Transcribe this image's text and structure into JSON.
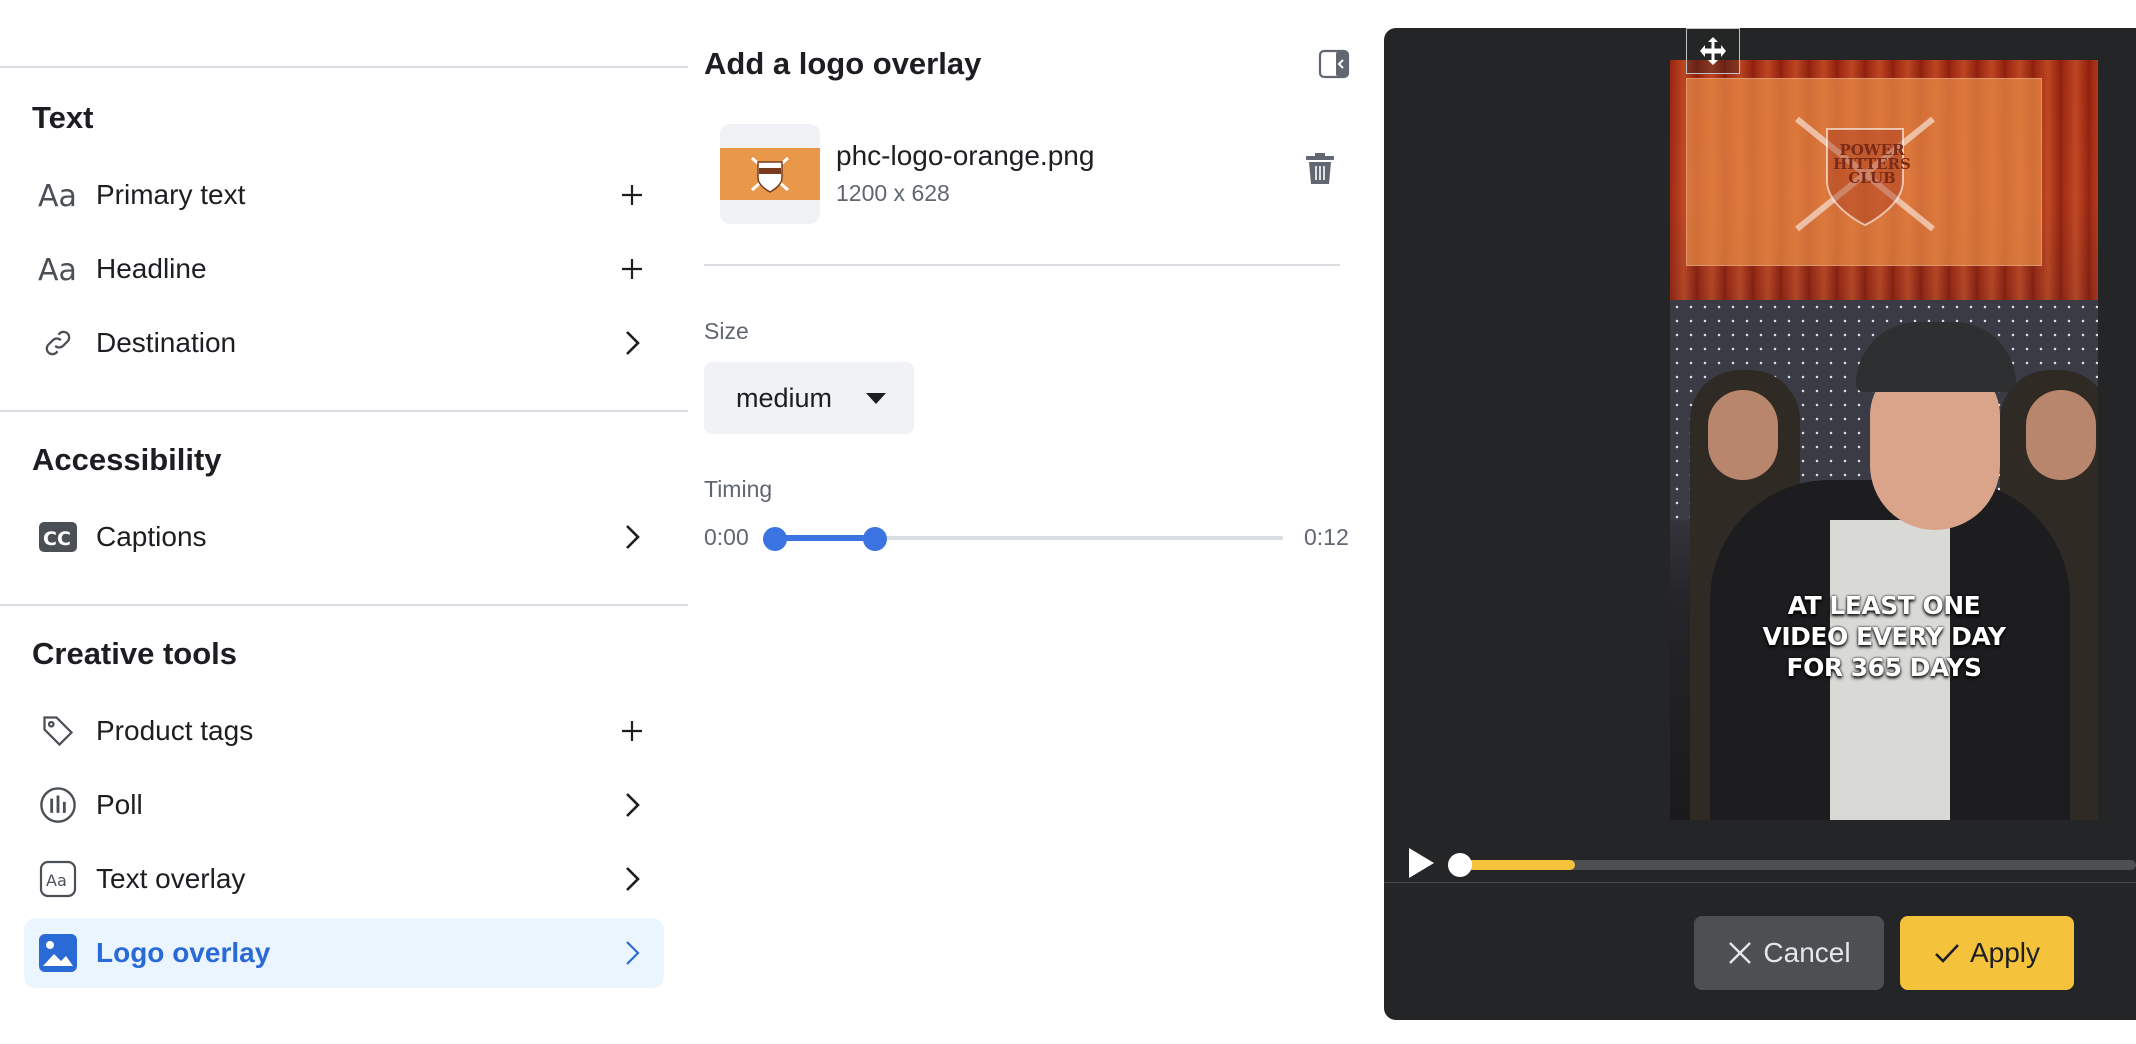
{
  "sidebar": {
    "sections": [
      {
        "title": "Text"
      },
      {
        "title": "Accessibility"
      },
      {
        "title": "Creative tools"
      }
    ],
    "items": [
      {
        "label": "Primary text",
        "icon": "text-aa-icon",
        "trail": "plus-icon"
      },
      {
        "label": "Headline",
        "icon": "text-aa-icon",
        "trail": "plus-icon"
      },
      {
        "label": "Destination",
        "icon": "link-icon",
        "trail": "chevron-right-icon"
      },
      {
        "label": "Captions",
        "icon": "cc-icon",
        "trail": "chevron-right-icon"
      },
      {
        "label": "Product tags",
        "icon": "tag-icon",
        "trail": "plus-icon"
      },
      {
        "label": "Poll",
        "icon": "poll-icon",
        "trail": "chevron-right-icon"
      },
      {
        "label": "Text overlay",
        "icon": "text-overlay-icon",
        "trail": "chevron-right-icon"
      },
      {
        "label": "Logo overlay",
        "icon": "image-icon",
        "trail": "chevron-right-icon",
        "active": true
      }
    ]
  },
  "panel": {
    "title": "Add a logo overlay",
    "file": {
      "name": "phc-logo-orange.png",
      "dimensions": "1200 x 628"
    },
    "size": {
      "label": "Size",
      "value": "medium"
    },
    "timing": {
      "label": "Timing",
      "start": "0:00",
      "end": "0:12",
      "range_start_fraction": 0.0,
      "range_end_fraction": 0.2
    }
  },
  "preview": {
    "logo_text": "POWER HITTERS CLUB",
    "caption_lines": [
      "AT LEAST ONE",
      "VIDEO EVERY DAY",
      "FOR 365 DAYS"
    ],
    "playback_progress_fraction": 0.17,
    "cancel_label": "Cancel",
    "apply_label": "Apply"
  },
  "colors": {
    "accent_blue": "#3b74e0",
    "active_bg": "#ebf5ff",
    "apply_yellow": "#f5c33b",
    "preview_bg": "#242526",
    "logo_orange": "#e99849"
  }
}
